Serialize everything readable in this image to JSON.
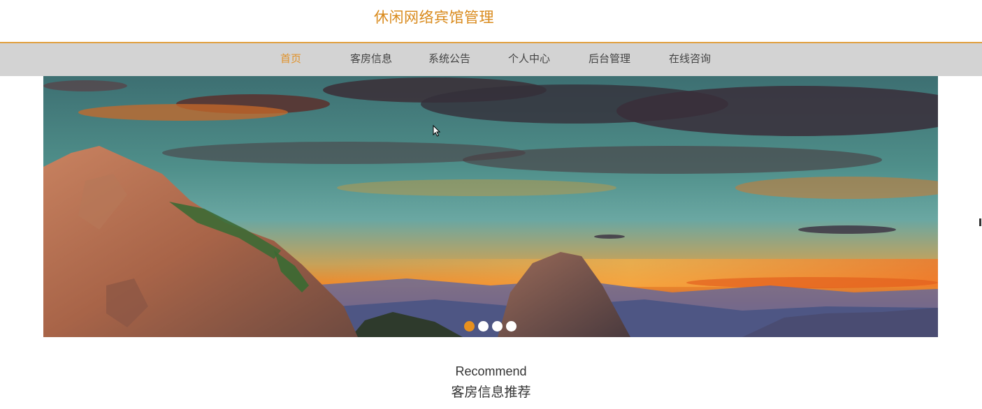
{
  "header": {
    "title": "休闲网络宾馆管理"
  },
  "nav": {
    "items": [
      {
        "label": "首页",
        "active": true
      },
      {
        "label": "客房信息",
        "active": false
      },
      {
        "label": "系统公告",
        "active": false
      },
      {
        "label": "个人中心",
        "active": false
      },
      {
        "label": "后台管理",
        "active": false
      },
      {
        "label": "在线咨询",
        "active": false
      }
    ]
  },
  "carousel": {
    "slide_count": 4,
    "active_index": 0,
    "image": "mountain-sunset-landscape"
  },
  "recommend": {
    "title_en": "Recommend",
    "title_zh": "客房信息推荐"
  },
  "colors": {
    "accent": "#e0922a",
    "nav_bg": "#d3d3d3",
    "title": "#d98a1c"
  }
}
